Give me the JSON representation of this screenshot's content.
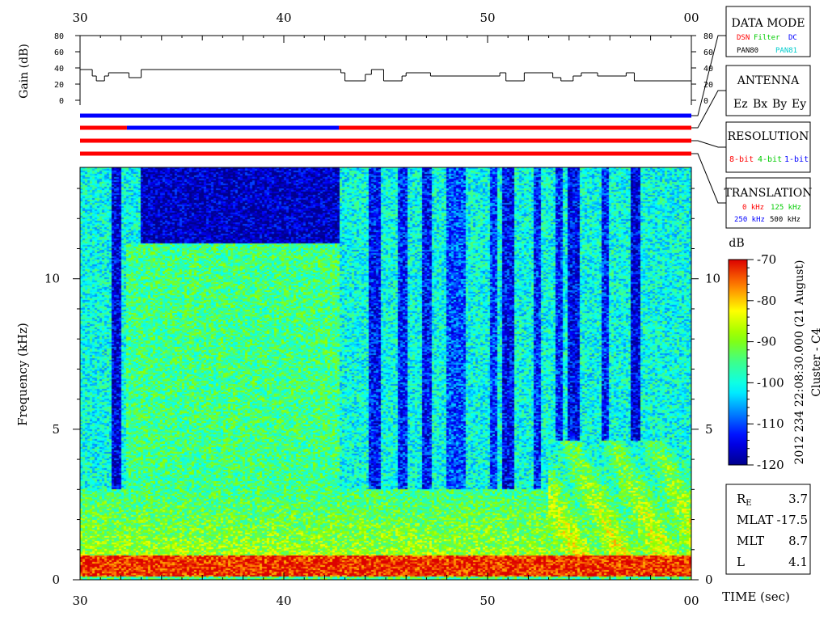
{
  "time_axis": {
    "ticks": [
      "30",
      "40",
      "50",
      "00"
    ],
    "xlabel": "TIME (sec)"
  },
  "gain_panel": {
    "ylabel": "Gain (dB)",
    "ticks": [
      "80",
      "60",
      "40",
      "20",
      "0"
    ]
  },
  "spectrogram": {
    "ylabel": "Frequency (kHz)",
    "ticks": [
      "10",
      "5",
      "0"
    ]
  },
  "colorbar": {
    "unit": "dB",
    "ticks": [
      "-70",
      "-80",
      "-90",
      "-100",
      "-110",
      "-120"
    ],
    "side_label_1": "2012 234 22:08:30.000 (21 August)",
    "side_label_2": "Cluster - C4"
  },
  "legend": {
    "data_mode": {
      "title": "DATA MODE",
      "items": [
        {
          "label": "DSN",
          "color": "#ff0000"
        },
        {
          "label": "Filter",
          "color": "#00cc00"
        },
        {
          "label": "DC",
          "color": "#0000ff"
        },
        {
          "label": "PAN80",
          "color": "#000000"
        },
        {
          "label": "PAN81",
          "color": "#00cccc"
        }
      ]
    },
    "antenna": {
      "title": "ANTENNA",
      "items": [
        {
          "label": "Ez",
          "color": "#ff0000"
        },
        {
          "label": "Bx",
          "color": "#00cc00"
        },
        {
          "label": "By",
          "color": "#0000ff"
        },
        {
          "label": "Ey",
          "color": "#000000"
        }
      ]
    },
    "resolution": {
      "title": "RESOLUTION",
      "items": [
        {
          "label": "8-bit",
          "color": "#ff0000"
        },
        {
          "label": "4-bit",
          "color": "#00cc00"
        },
        {
          "label": "1-bit",
          "color": "#0000ff"
        }
      ]
    },
    "translation": {
      "title": "TRANSLATION",
      "items": [
        {
          "label": "0 kHz",
          "color": "#ff0000"
        },
        {
          "label": "125 kHz",
          "color": "#00cc00"
        },
        {
          "label": "250 kHz",
          "color": "#0000ff"
        },
        {
          "label": "500 kHz",
          "color": "#000000"
        }
      ]
    }
  },
  "orbit_info": [
    {
      "key": "R",
      "sub": "E",
      "value": "3.7"
    },
    {
      "key": "MLAT",
      "sub": "",
      "value": "-17.5"
    },
    {
      "key": "MLT",
      "sub": "",
      "value": "8.7"
    },
    {
      "key": "L",
      "sub": "",
      "value": "4.1"
    }
  ],
  "chart_data": {
    "type": "heatmap",
    "time_range_s": [
      30,
      60
    ],
    "freq_range_khz": [
      0,
      13.7
    ],
    "gain_ylim": [
      0,
      80
    ],
    "color_range_db": [
      -120,
      -70
    ],
    "gain_steps": [
      {
        "t": 30.0,
        "g": 38
      },
      {
        "t": 30.6,
        "g": 30
      },
      {
        "t": 30.8,
        "g": 24
      },
      {
        "t": 31.2,
        "g": 30
      },
      {
        "t": 31.4,
        "g": 34
      },
      {
        "t": 32.4,
        "g": 28
      },
      {
        "t": 33.0,
        "g": 38
      },
      {
        "t": 42.8,
        "g": 34
      },
      {
        "t": 43.0,
        "g": 24
      },
      {
        "t": 44.0,
        "g": 32
      },
      {
        "t": 44.3,
        "g": 38
      },
      {
        "t": 44.9,
        "g": 24
      },
      {
        "t": 45.8,
        "g": 30
      },
      {
        "t": 46.0,
        "g": 34
      },
      {
        "t": 47.2,
        "g": 30
      },
      {
        "t": 50.6,
        "g": 34
      },
      {
        "t": 50.9,
        "g": 24
      },
      {
        "t": 51.8,
        "g": 34
      },
      {
        "t": 53.2,
        "g": 28
      },
      {
        "t": 53.6,
        "g": 24
      },
      {
        "t": 54.2,
        "g": 30
      },
      {
        "t": 54.6,
        "g": 34
      },
      {
        "t": 55.4,
        "g": 30
      },
      {
        "t": 56.8,
        "g": 34
      },
      {
        "t": 57.2,
        "g": 24
      },
      {
        "t": 60.0,
        "g": 24
      }
    ],
    "status_bars": [
      {
        "name": "data_mode",
        "segments": [
          {
            "t0": 30,
            "t1": 60,
            "color": "#0000ff"
          }
        ]
      },
      {
        "name": "antenna",
        "segments": [
          {
            "t0": 30,
            "t1": 32.3,
            "color": "#ff0000"
          },
          {
            "t0": 32.3,
            "t1": 42.7,
            "color": "#0000ff"
          },
          {
            "t0": 42.7,
            "t1": 60,
            "color": "#ff0000"
          }
        ]
      },
      {
        "name": "resolution",
        "segments": [
          {
            "t0": 30,
            "t1": 60,
            "color": "#ff0000"
          }
        ]
      },
      {
        "name": "translation",
        "segments": [
          {
            "t0": 30,
            "t1": 60,
            "color": "#ff0000"
          }
        ]
      }
    ],
    "baseline_db": -100,
    "low_freq_band": {
      "f_max_khz": 0.8,
      "db": -72
    },
    "quiet_region": {
      "t0": 33.0,
      "t1": 42.7,
      "f_min_khz": 11.2,
      "db": -117
    },
    "active_block": {
      "t0": 32.3,
      "t1": 42.7,
      "f_max_khz": 11.2,
      "db": -95
    },
    "dark_stripes": [
      {
        "t": 31.8,
        "w": 0.45,
        "db": -115
      },
      {
        "t": 44.4,
        "w": 0.6,
        "db": -113
      },
      {
        "t": 45.8,
        "w": 0.45,
        "db": -112
      },
      {
        "t": 47.0,
        "w": 0.5,
        "db": -113
      },
      {
        "t": 48.4,
        "w": 0.9,
        "db": -110
      },
      {
        "t": 50.3,
        "w": 0.35,
        "db": -111
      },
      {
        "t": 51.0,
        "w": 0.6,
        "db": -114
      },
      {
        "t": 52.4,
        "w": 0.35,
        "db": -112
      },
      {
        "t": 53.5,
        "w": 0.3,
        "db": -112
      },
      {
        "t": 54.2,
        "w": 0.55,
        "db": -114
      },
      {
        "t": 55.8,
        "w": 0.35,
        "db": -112
      },
      {
        "t": 57.2,
        "w": 0.45,
        "db": -115
      }
    ],
    "chorus_region": {
      "t0": 53.0,
      "t1": 60.0,
      "f_max_khz": 4.6,
      "db": -85
    }
  }
}
